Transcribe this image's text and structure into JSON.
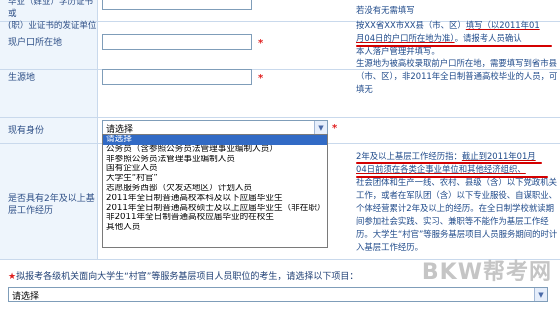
{
  "rows": {
    "top_label": "毕业（肄业）学历证书或\n(职）业证书的发证单位",
    "top_hint": "若没有无需填写",
    "residence_label": "现户口所在地",
    "residence_hint_plain1": "按XX省XX市XX县（市、区）",
    "residence_hint_u1": "填写（以2011年01",
    "residence_hint_u2": "月04日的户口所在地为准）",
    "residence_hint_plain2": "。请报考人员确认",
    "residence_hint_plain3": "本人落户管理并填写。",
    "origin_label": "生源地",
    "origin_hint": "生源地为被高校录取前户口所在地，需要填写到省市县（市、区），非2011年全日制普通高校毕业的人员，可填无",
    "status_label": "现有身份",
    "status_value": "请选择",
    "grassroots_label": "是否具有2年及以上基层工作经历",
    "grassroots_hint_plain1": "2年及以上基层工作经历指：",
    "grassroots_hint_u1": "截止到2011年01月",
    "grassroots_hint_u2": "04日前须在各类企事业单位和其他经济组织、",
    "grassroots_hint_rest": "社会团体和生产一线、农村、县级（含）以下党政机关工作，或者在军队团（含）以下专业服役、自谋职业、个体经营累计2年及以上的经历。在全日制学校就读期间参加社会实践、实习、兼职等不能作为基层工作经历。大学生“村官”等服务基层项目人员服务期间的时计入基层工作经历。"
  },
  "dropdown": {
    "options": [
      "请选择",
      "公务员（含参照公务员法管理事业编制人员）",
      "非参照公务员法管理事业编制人员",
      "国有企业人员",
      "大学生“村官”",
      "志愿服务西部（欠发达地区）计划人员",
      "2011年全日制普通高校本科及以下应届毕业生",
      "2011年全日制普通高校硕士及以上应届毕业生（非在职）",
      "非2011年全日制普通高校应届毕业的在校生",
      "其他人员"
    ],
    "selected_index": 0
  },
  "bottom": {
    "question_star": "★",
    "question_text": "拟报考各级机关面向大学生“村官”等服务基层项目人员职位的考生，请选择以下项目：",
    "select_value": "请选择"
  },
  "required_mark": "*",
  "watermark": "BKW帮考网",
  "colors": {
    "label_bg": "#eef5fc",
    "text_blue": "#1f3f74",
    "required_red": "#e02020",
    "highlight": "#316ac5"
  }
}
